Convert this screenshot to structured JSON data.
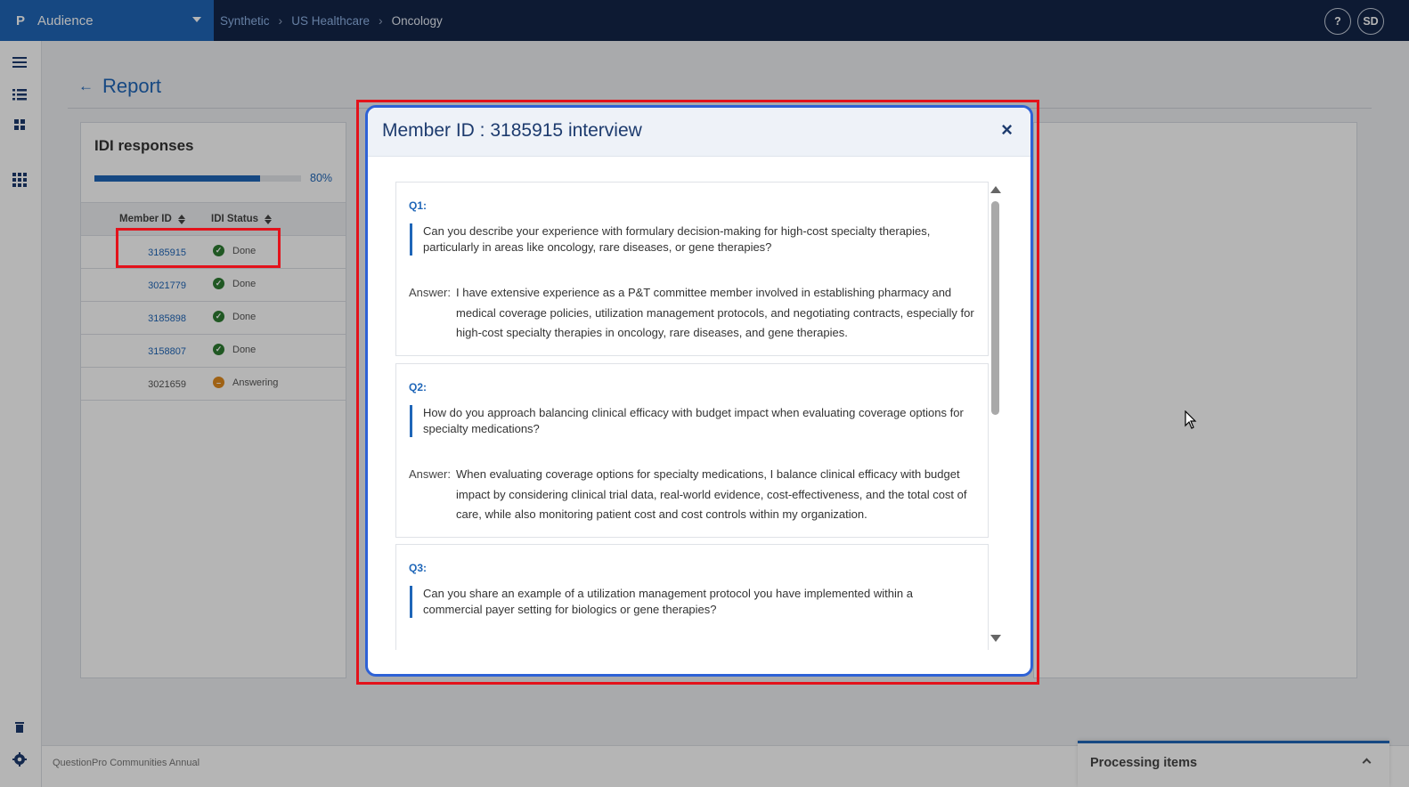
{
  "topbar": {
    "brand_logo": "P",
    "app_name": "Audience",
    "breadcrumbs": [
      "Synthetic",
      "US Healthcare",
      "Oncology"
    ],
    "help_label": "?",
    "user_initials": "SD"
  },
  "page": {
    "back_arrow": "←",
    "title": "Report"
  },
  "idi_panel": {
    "title": "IDI responses",
    "progress_percent": 80,
    "progress_label": "80%",
    "columns": [
      "Member ID",
      "IDI Status"
    ],
    "rows": [
      {
        "member_id": "3185915",
        "status": "Done"
      },
      {
        "member_id": "3021779",
        "status": "Done"
      },
      {
        "member_id": "3185898",
        "status": "Done"
      },
      {
        "member_id": "3158807",
        "status": "Done"
      },
      {
        "member_id": "3021659",
        "status": "Answering"
      }
    ]
  },
  "modal": {
    "title": "Member ID : 3185915 interview",
    "close_icon": "×",
    "answer_label": "Answer:",
    "questions": [
      {
        "label": "Q1:",
        "question": "Can you describe your experience with formulary decision-making for high-cost specialty therapies, particularly in areas like oncology, rare diseases, or gene therapies?",
        "answer": "I have extensive experience as a P&T committee member involved in establishing pharmacy and medical coverage policies, utilization management protocols, and negotiating contracts, especially for high-cost specialty therapies in oncology, rare diseases, and gene therapies."
      },
      {
        "label": "Q2:",
        "question": "How do you approach balancing clinical efficacy with budget impact when evaluating coverage options for specialty medications?",
        "answer": "When evaluating coverage options for specialty medications, I balance clinical efficacy with budget impact by considering clinical trial data, real-world evidence, cost-effectiveness, and the total cost of care, while also monitoring patient cost and cost controls within my organization."
      },
      {
        "label": "Q3:",
        "question": "Can you share an example of a utilization management protocol you have implemented within a commercial payer setting for biologics or gene therapies?",
        "answer": ""
      }
    ]
  },
  "footer": {
    "text": "QuestionPro Communities Annual",
    "processing_label": "Processing items"
  },
  "colors": {
    "topbar": "#132548",
    "brand": "#1f66b8",
    "accent": "#1f66b8",
    "highlight": "#e3121b",
    "done": "#2e7d32",
    "answering": "#e08a1e"
  }
}
